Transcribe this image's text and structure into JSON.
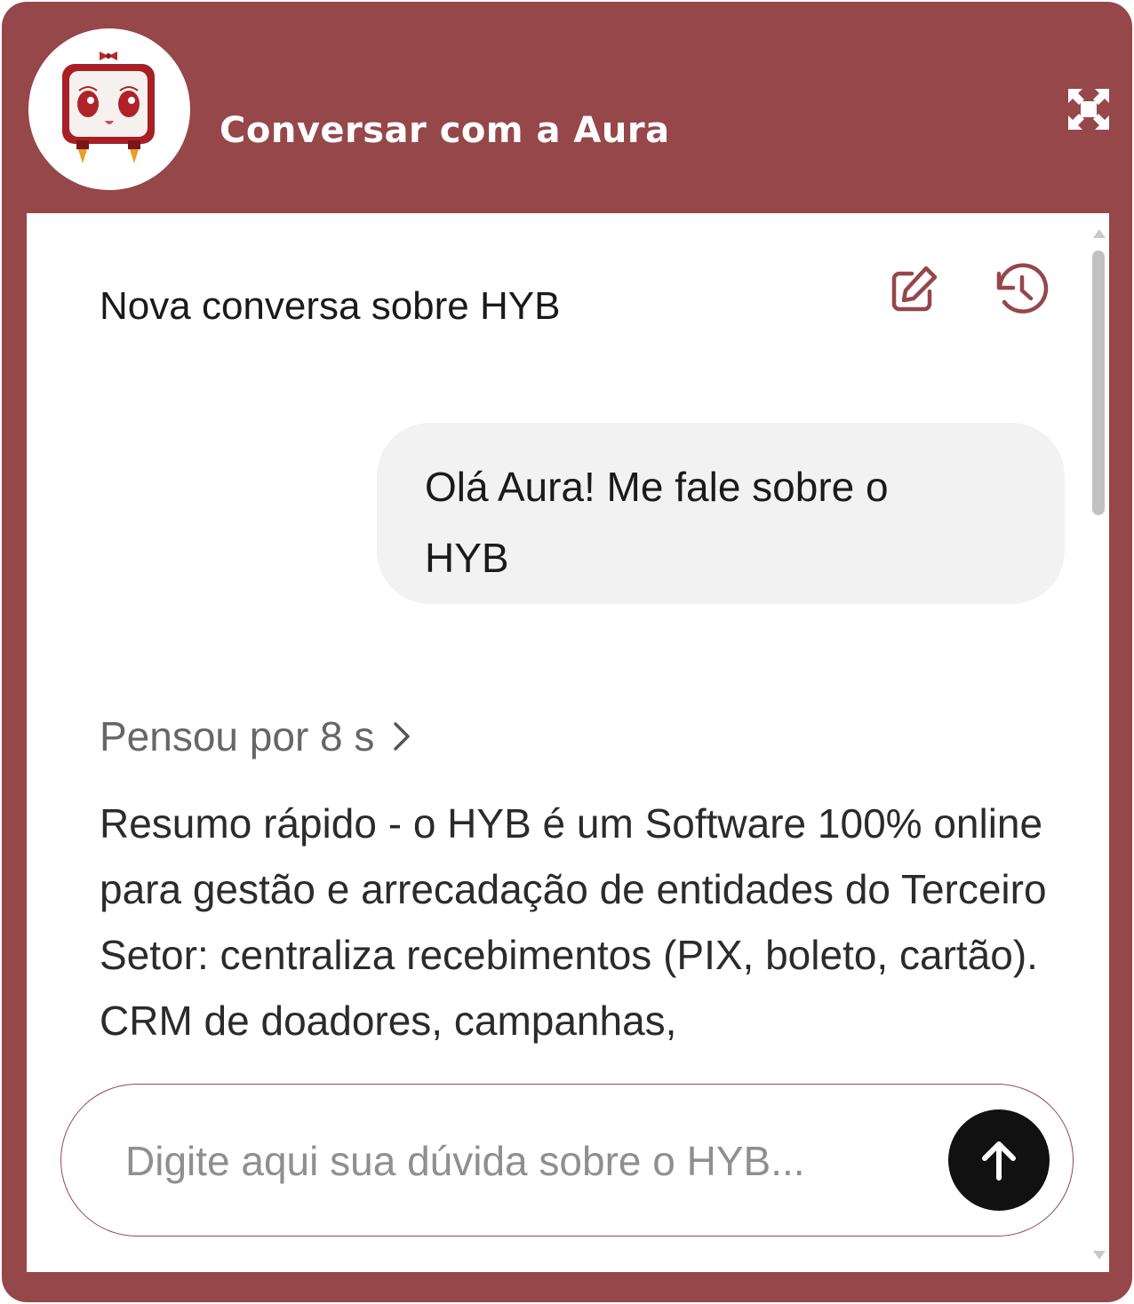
{
  "header": {
    "title": "Conversar com a Aura",
    "avatar_icon": "aura-robot-avatar",
    "expand_icon": "expand-icon"
  },
  "conversation": {
    "title": "Nova conversa sobre HYB",
    "edit_icon": "edit-icon",
    "history_icon": "history-icon"
  },
  "messages": {
    "user": "Olá Aura! Me fale sobre o HYB",
    "thought_label": "Pensou por 8 s",
    "assistant": "Resumo rápido - o HYB é um Software 100% online para gestão e arrecadação de entidades do Terceiro Setor: centraliza recebimentos (PIX, boleto, cartão). CRM de doadores, campanhas,"
  },
  "input": {
    "placeholder": "Digite aqui sua dúvida sobre o HYB...",
    "value": ""
  },
  "colors": {
    "brand": "#96474a",
    "send_button": "#111111",
    "bubble": "#f2f2f2"
  }
}
